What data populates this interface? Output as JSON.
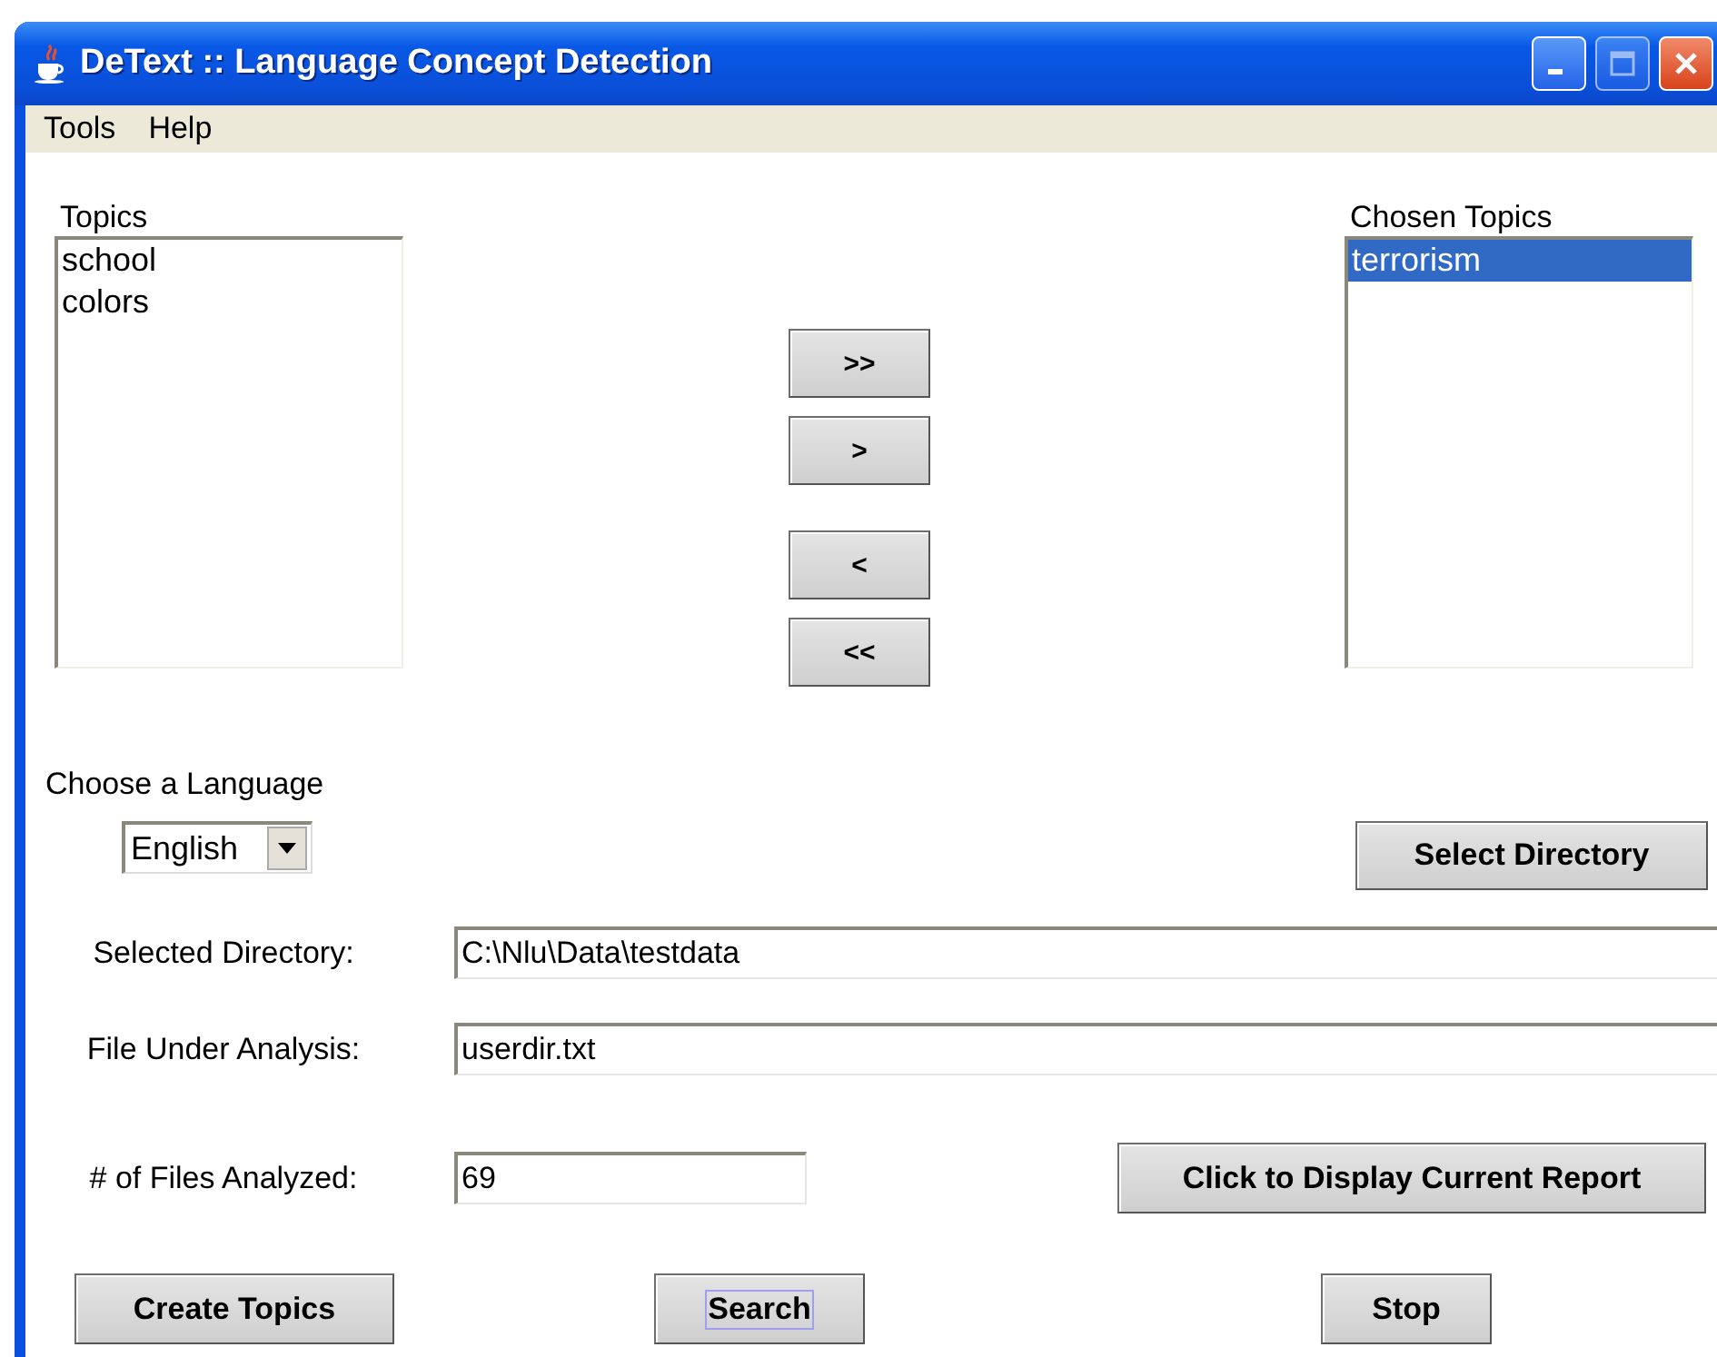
{
  "window": {
    "title": "DeText :: Language Concept Detection"
  },
  "menu": [
    "Tools",
    "Help"
  ],
  "topics": {
    "label": "Topics",
    "items": [
      {
        "text": "school",
        "selected": false
      },
      {
        "text": "colors",
        "selected": false
      }
    ]
  },
  "move_buttons": [
    ">>",
    ">",
    "<",
    "<<"
  ],
  "chosen_topics": {
    "label": "Chosen Topics",
    "items": [
      {
        "text": "terrorism",
        "selected": true
      }
    ]
  },
  "language": {
    "label": "Choose a Language",
    "value": "English"
  },
  "select_directory_button": "Select Directory",
  "fields": [
    {
      "label": "Selected Directory:",
      "value": "C:\\Nlu\\Data\\testdata"
    },
    {
      "label": "File Under Analysis:",
      "value": "userdir.txt"
    },
    {
      "label": "# of Files Analyzed:",
      "value": "69"
    }
  ],
  "report_button": "Click to Display Current Report",
  "bottom_buttons": [
    {
      "label": "Create Topics",
      "focused": false
    },
    {
      "label": "Search",
      "focused": true
    },
    {
      "label": "Stop",
      "focused": false
    }
  ]
}
